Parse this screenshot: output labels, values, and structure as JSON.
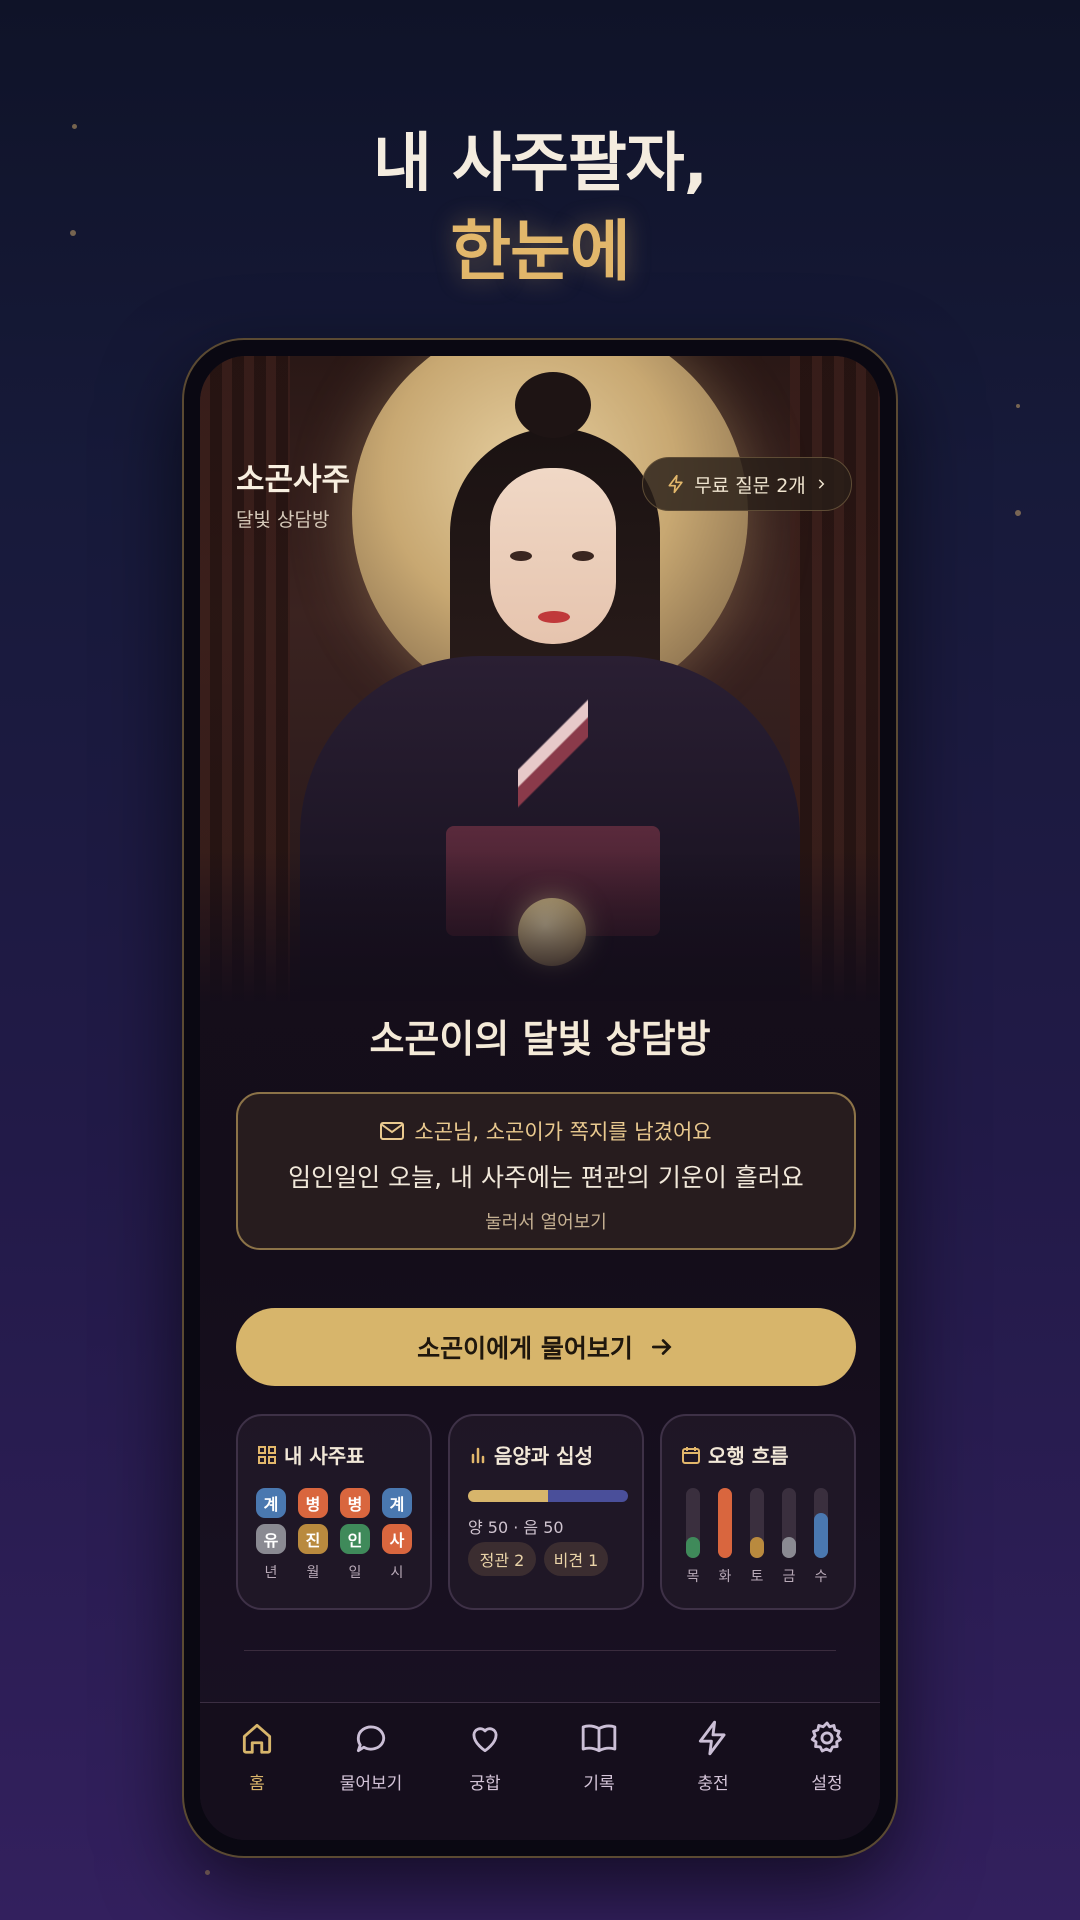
{
  "headline": {
    "line1": "내 사주팔자,",
    "line2": "한눈에"
  },
  "app": {
    "brand_title": "소곤사주",
    "brand_subtitle": "달빛 상담방",
    "free_question_badge": "무료 질문 2개",
    "room_title": "소곤이의 달빛 상담방"
  },
  "message_card": {
    "header": "소곤님, 소곤이가 쪽지를 남겼어요",
    "body": "임인일인 오늘, 내 사주에는 편관의 기운이 흘러요",
    "hint": "눌러서 열어보기"
  },
  "ask_button": {
    "label": "소곤이에게 물어보기"
  },
  "cards": {
    "saju_table": {
      "title": "내 사주표",
      "stems": [
        "계",
        "병",
        "병",
        "계"
      ],
      "branches": [
        "유",
        "진",
        "인",
        "사"
      ],
      "pillars": [
        "년",
        "월",
        "일",
        "시"
      ],
      "stem_colors": [
        "#4a78b0",
        "#d9663e",
        "#d9663e",
        "#4a78b0"
      ],
      "branch_colors": [
        "#8a8a92",
        "#b98a3e",
        "#3f8a5a",
        "#d9663e"
      ]
    },
    "yin_yang": {
      "title": "음양과 십성",
      "yang": 50,
      "yin": 50,
      "summary": "양 50 · 음 50",
      "tags": [
        "정관 2",
        "비견 1"
      ],
      "yang_color": "#d7b56b",
      "yin_color": "#4a4f9a"
    },
    "five_elements": {
      "title": "오행 흐름",
      "elements": [
        {
          "label": "목",
          "level": 0.3,
          "color": "#3f8a5a"
        },
        {
          "label": "화",
          "level": 1.0,
          "color": "#d9663e"
        },
        {
          "label": "토",
          "level": 0.3,
          "color": "#b98a3e"
        },
        {
          "label": "금",
          "level": 0.3,
          "color": "#8a8a92"
        },
        {
          "label": "수",
          "level": 0.65,
          "color": "#4a78b0"
        }
      ]
    }
  },
  "nav": {
    "items": [
      {
        "label": "홈",
        "icon": "home-icon",
        "active": true
      },
      {
        "label": "물어보기",
        "icon": "chat-bubble-icon",
        "active": false
      },
      {
        "label": "궁합",
        "icon": "heart-icon",
        "active": false
      },
      {
        "label": "기록",
        "icon": "book-icon",
        "active": false
      },
      {
        "label": "충전",
        "icon": "lightning-icon",
        "active": false
      },
      {
        "label": "설정",
        "icon": "gear-icon",
        "active": false
      }
    ]
  },
  "colors": {
    "accent": "#d7b56b",
    "accent_text": "#e2b76b"
  }
}
